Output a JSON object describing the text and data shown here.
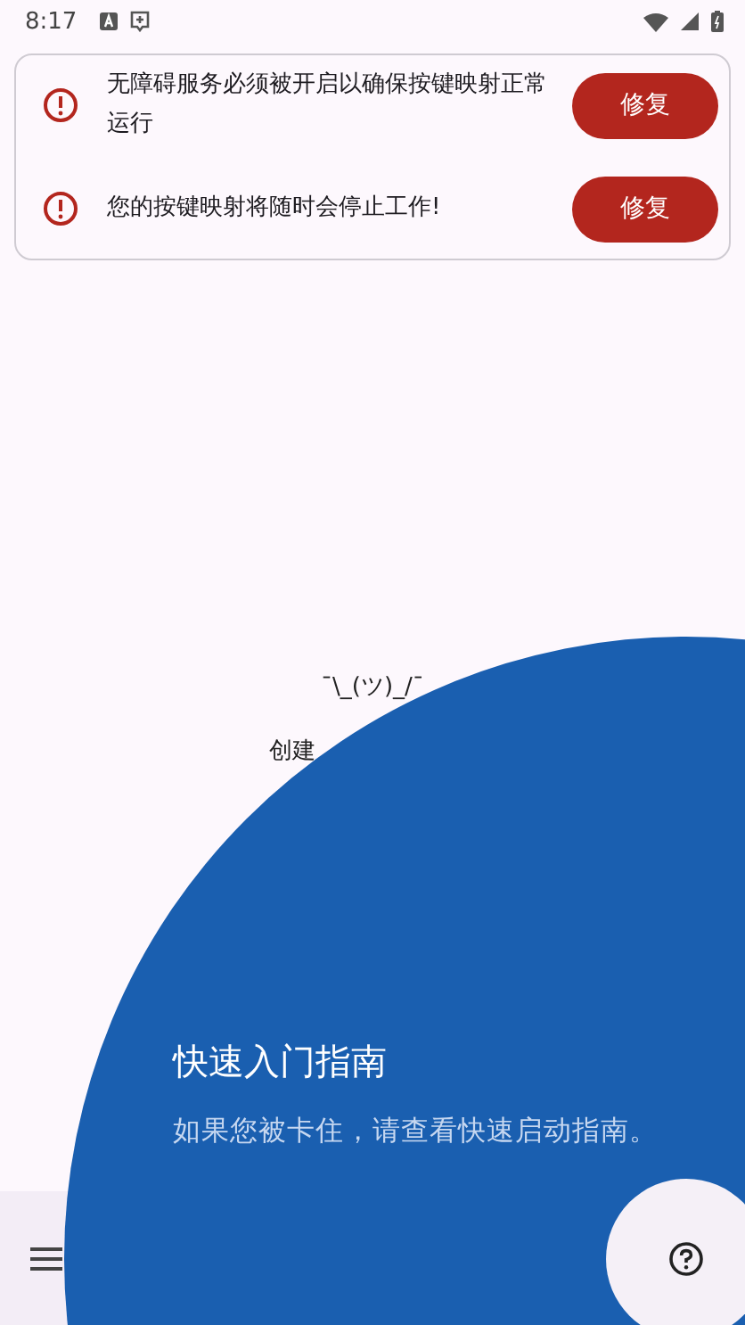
{
  "status_bar": {
    "time": "8:17"
  },
  "alerts": [
    {
      "message": "无障碍服务必须被开启以确保按键映射正常运行",
      "button": "修复"
    },
    {
      "message": "您的按键映射将随时会停止工作!",
      "button": "修复"
    }
  ],
  "empty_state": {
    "emoticon": "¯\\_(ツ)_/¯",
    "text": "创建"
  },
  "tutorial": {
    "title": "快速入门指南",
    "description": "如果您被卡住，请查看快速启动指南。"
  }
}
